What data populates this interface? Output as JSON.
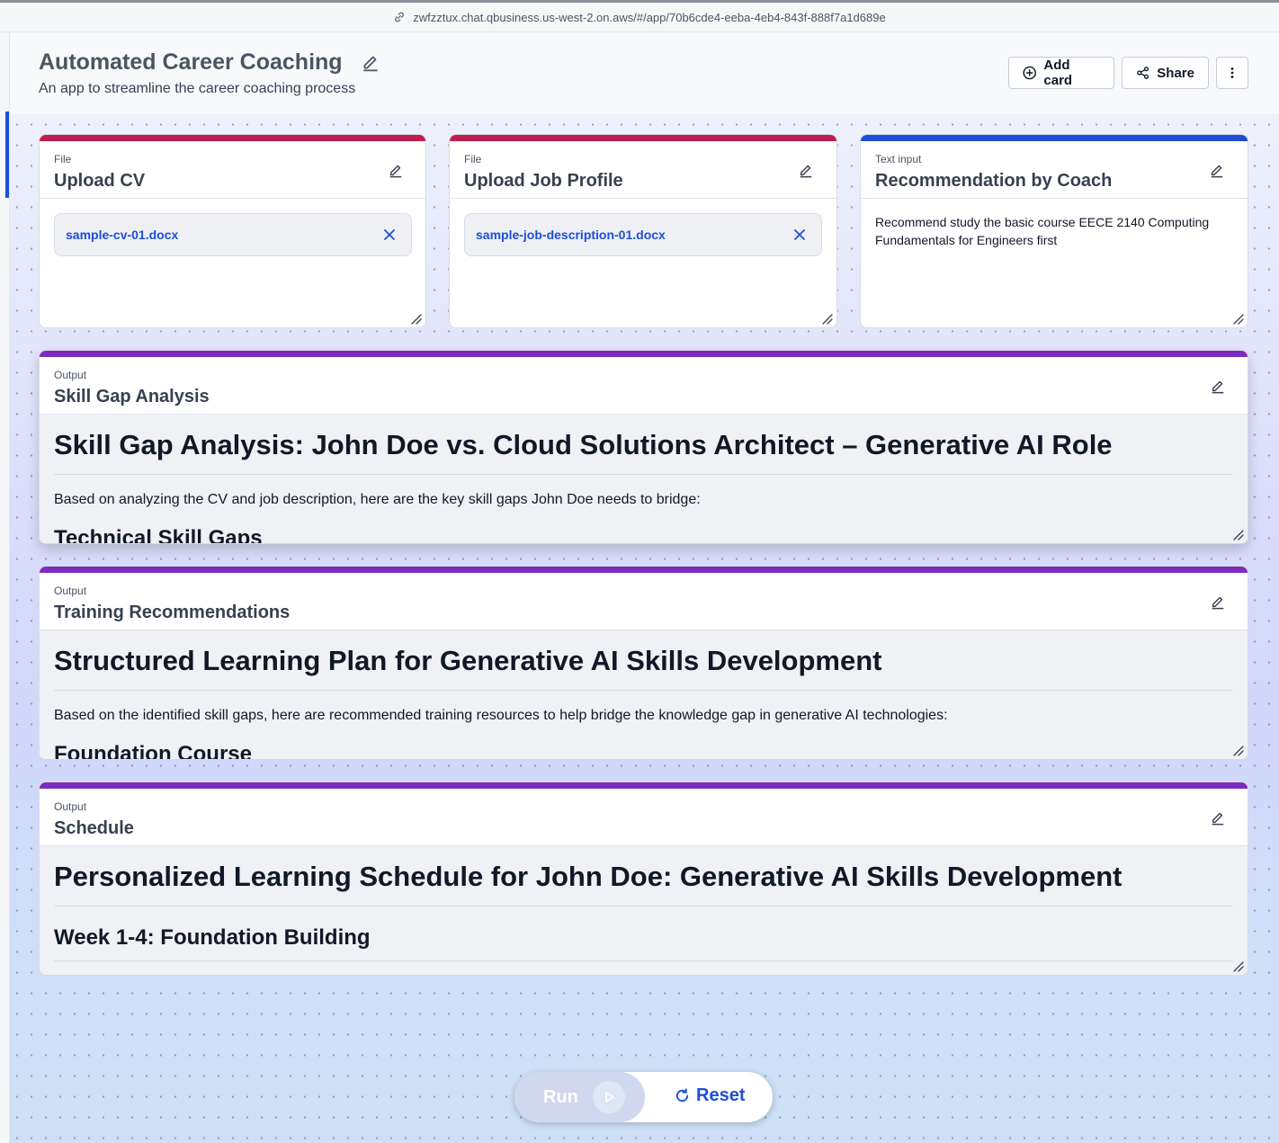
{
  "browser": {
    "url": "zwfzztux.chat.qbusiness.us-west-2.on.aws/#/app/70b6cde4-eeba-4eb4-843f-888f7a1d689e"
  },
  "app": {
    "title": "Automated Career Coaching",
    "subtitle": "An app to streamline the career coaching process",
    "add_card_label": "Add card",
    "share_label": "Share"
  },
  "cards": {
    "upload_cv": {
      "type": "File",
      "title": "Upload CV",
      "file_name": "sample-cv-01.docx"
    },
    "upload_job": {
      "type": "File",
      "title": "Upload Job Profile",
      "file_name": "sample-job-description-01.docx"
    },
    "recommendation": {
      "type": "Text input",
      "title": "Recommendation by Coach",
      "value": "Recommend study the basic course EECE 2140 Computing Fundamentals for Engineers first"
    },
    "skill_gap": {
      "type": "Output",
      "title": "Skill Gap Analysis",
      "heading": "Skill Gap Analysis: John Doe vs. Cloud Solutions Architect – Generative AI Role",
      "paragraph": "Based on analyzing the CV and job description, here are the key skill gaps John Doe needs to bridge:",
      "subheading": "Technical Skill Gaps"
    },
    "training": {
      "type": "Output",
      "title": "Training Recommendations",
      "heading": "Structured Learning Plan for Generative AI Skills Development",
      "paragraph": "Based on the identified skill gaps, here are recommended training resources to help bridge the knowledge gap in generative AI technologies:",
      "subheading": "Foundation Course"
    },
    "schedule": {
      "type": "Output",
      "title": "Schedule",
      "heading": "Personalized Learning Schedule for John Doe: Generative AI Skills Development",
      "subheading": "Week 1-4: Foundation Building"
    }
  },
  "controls": {
    "run_label": "Run",
    "reset_label": "Reset"
  },
  "colors": {
    "file_accent": "#be1e4b",
    "text_input_accent": "#1d4ed8",
    "output_accent": "#7b2cbf",
    "link_blue": "#1d4ed8"
  }
}
